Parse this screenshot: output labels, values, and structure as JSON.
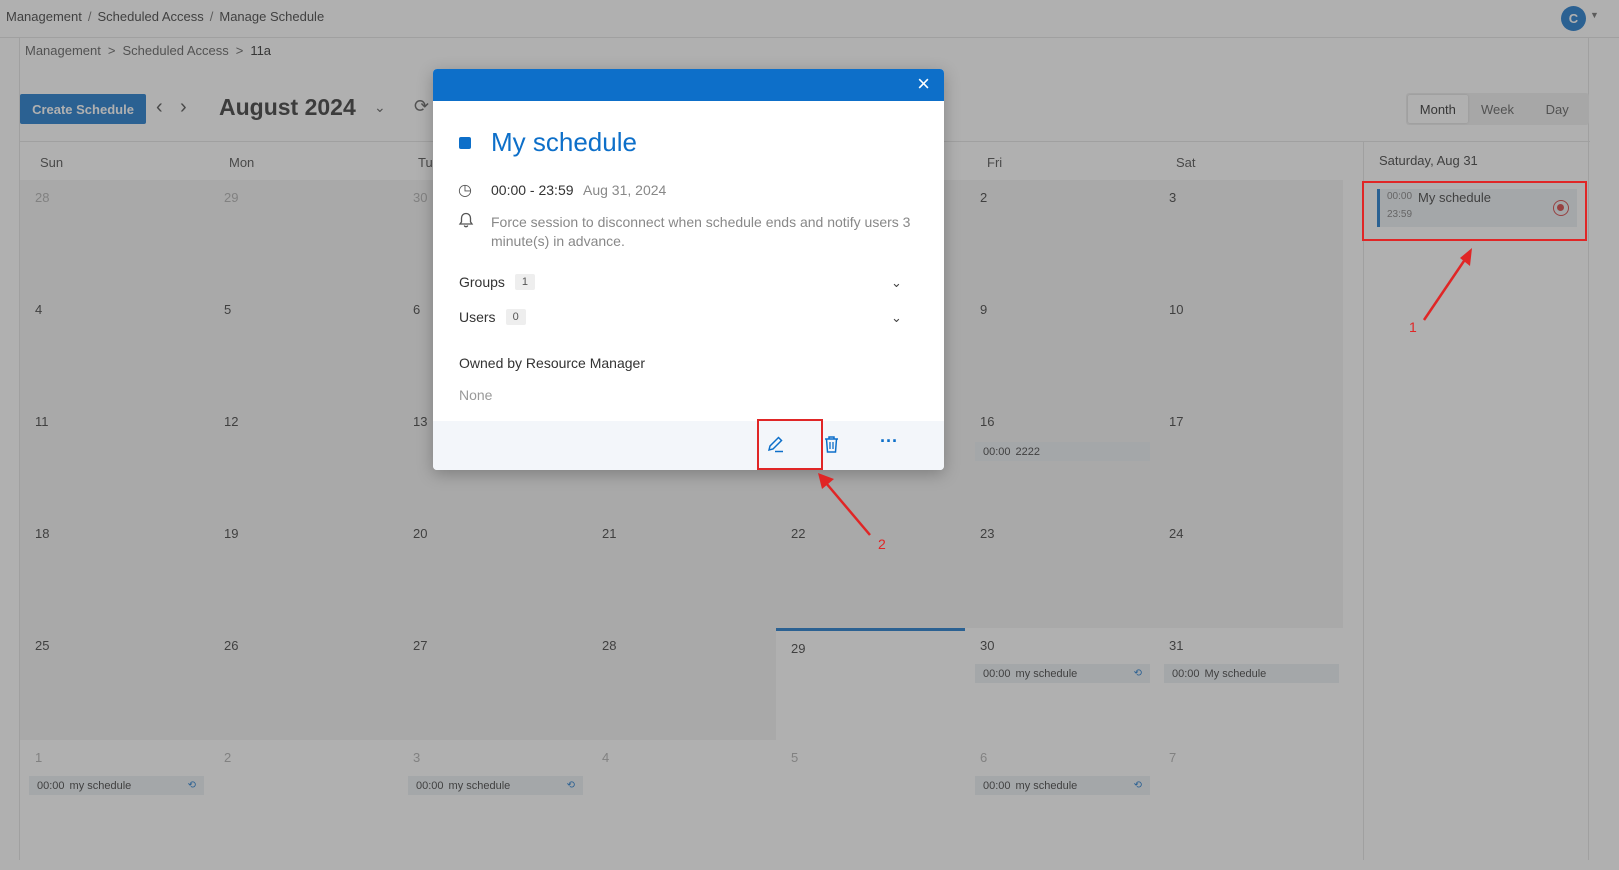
{
  "topbar": {
    "breadcrumb": [
      "Management",
      "Scheduled Access",
      "Manage Schedule"
    ],
    "separator": "/",
    "avatar_initial": "C"
  },
  "subcrumb": {
    "items": [
      "Management",
      "Scheduled Access",
      "11a"
    ],
    "separator": ">"
  },
  "toolbar": {
    "create_label": "Create Schedule",
    "month_title": "August 2024",
    "views": [
      "Month",
      "Week",
      "Day"
    ],
    "active_view": "Month"
  },
  "calendar": {
    "weekdays": [
      "Sun",
      "Mon",
      "Tu",
      "",
      "",
      "Fri",
      "Sat"
    ],
    "weeks": [
      [
        "28",
        "29",
        "30",
        "",
        "",
        "2",
        "3"
      ],
      [
        "4",
        "5",
        "6",
        "",
        "",
        "9",
        "10"
      ],
      [
        "11",
        "12",
        "13",
        "",
        "",
        "16",
        "17"
      ],
      [
        "18",
        "19",
        "20",
        "21",
        "22",
        "23",
        "24"
      ],
      [
        "25",
        "26",
        "27",
        "28",
        "29",
        "30",
        "31"
      ],
      [
        "1",
        "2",
        "3",
        "4",
        "5",
        "6",
        "7"
      ]
    ],
    "events": [
      {
        "week": 2,
        "day": 5,
        "time": "00:00",
        "name": "2222",
        "repeat": false
      },
      {
        "week": 4,
        "day": 5,
        "time": "00:00",
        "name": "my schedule",
        "repeat": true
      },
      {
        "week": 4,
        "day": 6,
        "time": "00:00",
        "name": "My schedule",
        "repeat": false
      },
      {
        "week": 5,
        "day": 0,
        "time": "00:00",
        "name": "my schedule",
        "repeat": true
      },
      {
        "week": 5,
        "day": 2,
        "time": "00:00",
        "name": "my schedule",
        "repeat": true
      },
      {
        "week": 5,
        "day": 5,
        "time": "00:00",
        "name": "my schedule",
        "repeat": true
      }
    ]
  },
  "side_panel": {
    "title": "Saturday, Aug 31",
    "event": {
      "start": "00:00",
      "end": "23:59",
      "name": "My schedule"
    }
  },
  "modal": {
    "title": "My schedule",
    "time_range": "00:00 - 23:59",
    "date": "Aug 31, 2024",
    "notice": "Force session to disconnect when schedule ends and notify users 3 minute(s) in advance.",
    "groups_label": "Groups",
    "groups_count": "1",
    "users_label": "Users",
    "users_count": "0",
    "owner_label": "Owned by Resource Manager",
    "owner_value": "None"
  },
  "annotations": [
    "1",
    "2"
  ],
  "colors": {
    "accent": "#0d6fc9",
    "highlight": "#e02626"
  }
}
